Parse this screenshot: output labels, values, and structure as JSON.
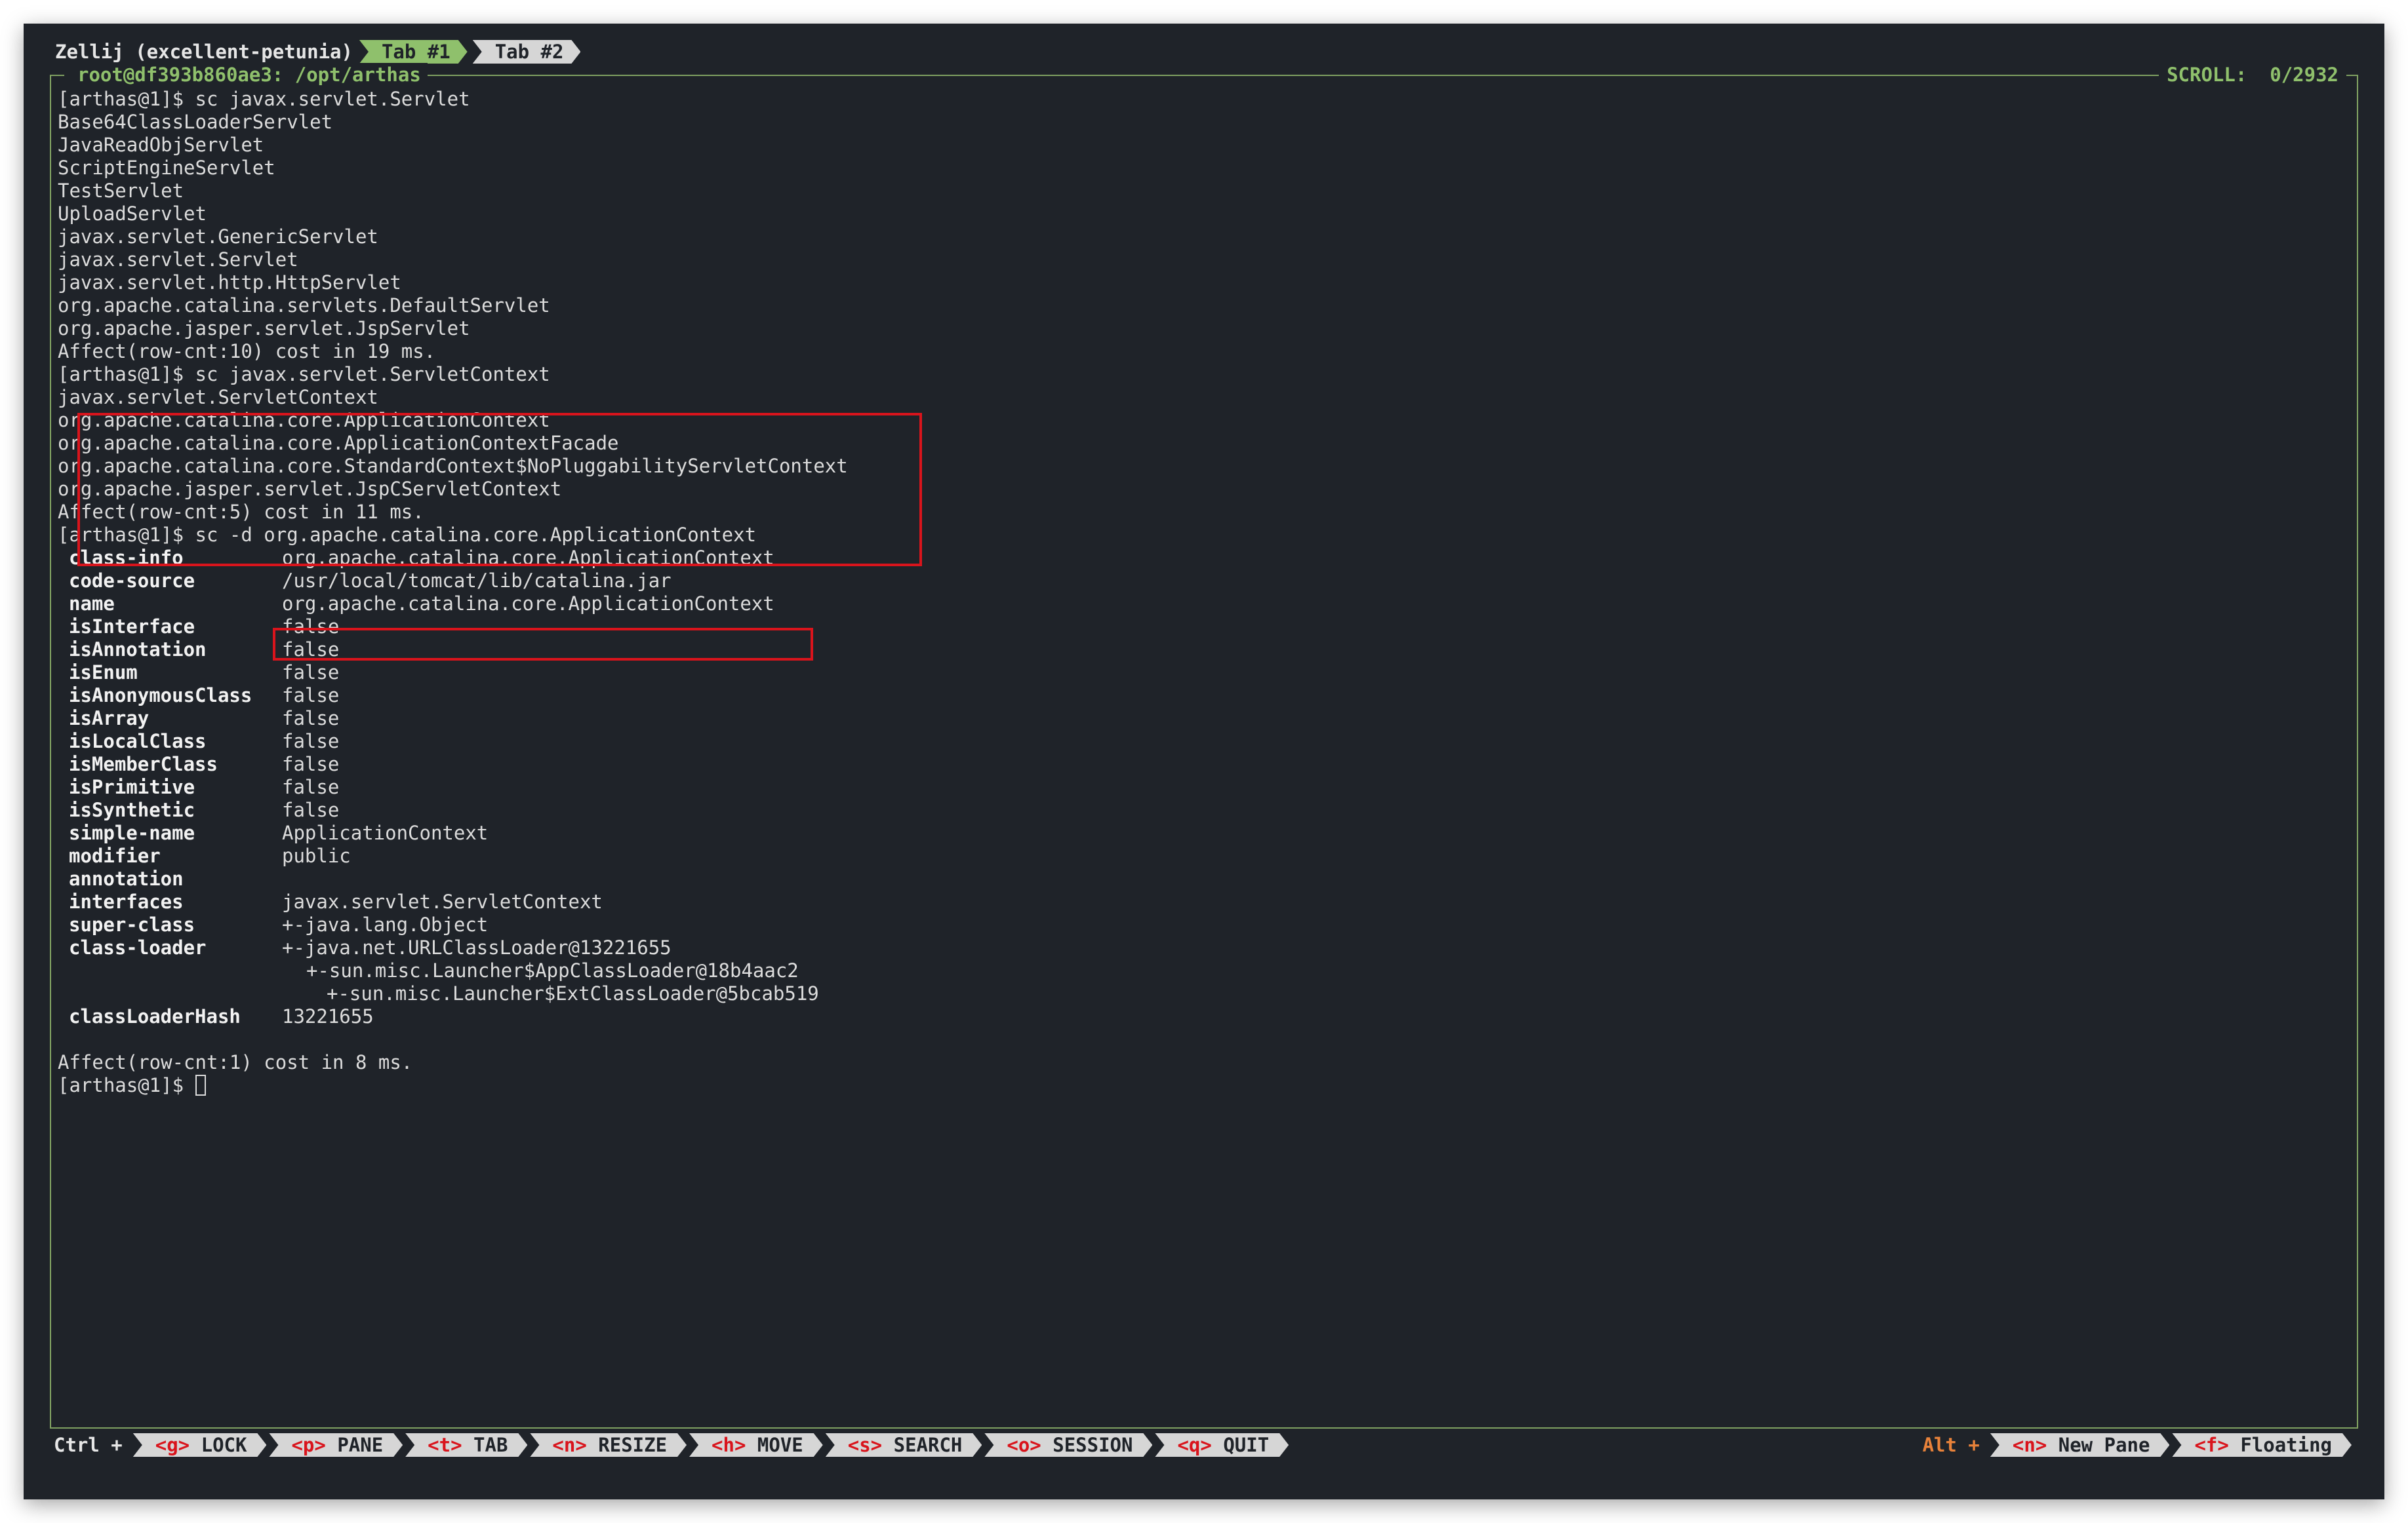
{
  "tabbar": {
    "session_title": "Zellij (excellent-petunia)",
    "tabs": [
      {
        "label": "Tab #1",
        "active": true
      },
      {
        "label": "Tab #2",
        "active": false
      }
    ]
  },
  "pane": {
    "title": "root@df393b860ae3: /opt/arthas",
    "scroll_label": "SCROLL:",
    "scroll_value": "0/2932"
  },
  "terminal": {
    "lines": [
      "[arthas@1]$ sc javax.servlet.Servlet",
      "Base64ClassLoaderServlet",
      "JavaReadObjServlet",
      "ScriptEngineServlet",
      "TestServlet",
      "UploadServlet",
      "javax.servlet.GenericServlet",
      "javax.servlet.Servlet",
      "javax.servlet.http.HttpServlet",
      "org.apache.catalina.servlets.DefaultServlet",
      "org.apache.jasper.servlet.JspServlet",
      "Affect(row-cnt:10) cost in 19 ms.",
      "[arthas@1]$ sc javax.servlet.ServletContext",
      "javax.servlet.ServletContext",
      "org.apache.catalina.core.ApplicationContext",
      "org.apache.catalina.core.ApplicationContextFacade",
      "org.apache.catalina.core.StandardContext$NoPluggabilityServletContext",
      "org.apache.jasper.servlet.JspCServletContext",
      "Affect(row-cnt:5) cost in 11 ms.",
      "[arthas@1]$ sc -d org.apache.catalina.core.ApplicationContext"
    ],
    "details": [
      {
        "key": "class-info",
        "value": "org.apache.catalina.core.ApplicationContext"
      },
      {
        "key": "code-source",
        "value": "/usr/local/tomcat/lib/catalina.jar"
      },
      {
        "key": "name",
        "value": "org.apache.catalina.core.ApplicationContext"
      },
      {
        "key": "isInterface",
        "value": "false"
      },
      {
        "key": "isAnnotation",
        "value": "false"
      },
      {
        "key": "isEnum",
        "value": "false"
      },
      {
        "key": "isAnonymousClass",
        "value": "false"
      },
      {
        "key": "isArray",
        "value": "false"
      },
      {
        "key": "isLocalClass",
        "value": "false"
      },
      {
        "key": "isMemberClass",
        "value": "false"
      },
      {
        "key": "isPrimitive",
        "value": "false"
      },
      {
        "key": "isSynthetic",
        "value": "false"
      },
      {
        "key": "simple-name",
        "value": "ApplicationContext"
      },
      {
        "key": "modifier",
        "value": "public"
      },
      {
        "key": "annotation",
        "value": ""
      },
      {
        "key": "interfaces",
        "value": "javax.servlet.ServletContext"
      },
      {
        "key": "super-class",
        "value": "+-java.lang.Object"
      },
      {
        "key": "class-loader",
        "value": "+-java.net.URLClassLoader@13221655"
      },
      {
        "key": "",
        "value": "+-sun.misc.Launcher$AppClassLoader@18b4aac2"
      },
      {
        "key": "",
        "value": "+-sun.misc.Launcher$ExtClassLoader@5bcab519"
      },
      {
        "key": "classLoaderHash",
        "value": "13221655"
      }
    ],
    "footer": "Affect(row-cnt:1) cost in 8 ms.",
    "prompt": "[arthas@1]$ "
  },
  "statusbar": {
    "ctrl_label": "Ctrl +",
    "ctrl_keys": [
      {
        "key": "<g>",
        "label": "LOCK"
      },
      {
        "key": "<p>",
        "label": "PANE"
      },
      {
        "key": "<t>",
        "label": "TAB"
      },
      {
        "key": "<n>",
        "label": "RESIZE"
      },
      {
        "key": "<h>",
        "label": "MOVE"
      },
      {
        "key": "<s>",
        "label": "SEARCH"
      },
      {
        "key": "<o>",
        "label": "SESSION"
      },
      {
        "key": "<q>",
        "label": "QUIT"
      }
    ],
    "alt_label": "Alt +",
    "alt_keys": [
      {
        "key": "<n>",
        "label": "New Pane"
      },
      {
        "key": "<f>",
        "label": "Floating"
      }
    ]
  },
  "colors": {
    "background": "#1f2329",
    "accent_green": "#8fc06c",
    "highlight_red": "#d9141c",
    "alt_orange": "#e8823a"
  }
}
